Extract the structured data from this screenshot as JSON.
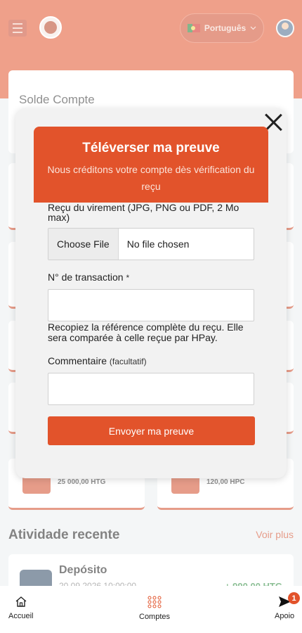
{
  "header": {
    "language": "Português",
    "menu_icon": "hamburger-icon",
    "logo_icon": "brand-logo",
    "flag_icon": "portugal-flag-icon",
    "avatar_icon": "user-avatar"
  },
  "balance": {
    "title": "Solde Compte"
  },
  "tiles": [
    {
      "value": "25 000,00 HTG",
      "icon": "piggy-bank-icon"
    },
    {
      "value": "120,00 HPC",
      "icon": "gift-icon"
    }
  ],
  "recent": {
    "title": "Atividade recente",
    "see_more": "Voir plus",
    "items": [
      {
        "name": "Depósito",
        "date": "20.09.2026 10:00:00",
        "amount": "+ 990,00 HTG",
        "icon": "bank-icon"
      }
    ]
  },
  "modal": {
    "title": "Téléverser ma preuve",
    "subtitle": "Nous créditons votre compte dès vérification du reçu",
    "receipt_label": "Reçu du virement (JPG, PNG ou PDF, 2 Mo max)",
    "file_button": "Choose File",
    "file_status": "No file chosen",
    "transaction_label": "N° de transaction",
    "required_mark": "*",
    "transaction_value": "",
    "hint": "Recopiez la référence complète du reçu. Elle sera comparée à celle reçue par HPay.",
    "comment_label": "Commentaire",
    "comment_optional": "(facultatif)",
    "comment_value": "",
    "submit": "Envoyer ma preuve",
    "close_icon": "close-icon"
  },
  "bottom_nav": {
    "items": [
      {
        "label": "Accueil",
        "icon": "home-icon"
      },
      {
        "label": "Comptes",
        "icon": "grid-dots-icon"
      },
      {
        "label": "Apoio",
        "icon": "send-icon"
      }
    ],
    "badge": "1"
  },
  "colors": {
    "brand": "#e2532b",
    "positive": "#2e8b3e"
  }
}
